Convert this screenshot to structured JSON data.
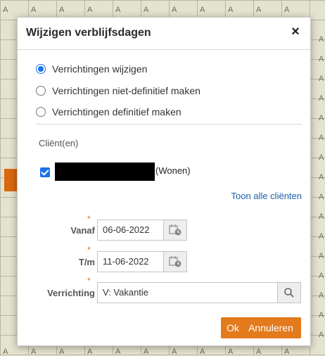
{
  "background": {
    "letter": "A"
  },
  "dialog": {
    "title": "Wijzigen verblijfsdagen",
    "close_label": "×",
    "options": [
      {
        "label": "Verrichtingen wijzigen",
        "checked": true
      },
      {
        "label": "Verrichtingen niet-definitief maken",
        "checked": false
      },
      {
        "label": "Verrichtingen definitief maken",
        "checked": false
      }
    ],
    "clients_label": "Cliënt(en)",
    "client_suffix": "(Wonen)",
    "client_checked": true,
    "show_all_label": "Toon alle cliënten",
    "from_label": "Vanaf",
    "from_value": "06-06-2022",
    "to_label": "T/m",
    "to_value": "11-06-2022",
    "action_label": "Verrichting",
    "action_value": "V: Vakantie",
    "required_marker": "*",
    "ok_label": "Ok",
    "cancel_label": "Annuleren"
  },
  "colors": {
    "accent": "#e37a1c",
    "radio_selected": "#1a73e8",
    "link": "#1a5fa8"
  },
  "icons": {
    "calendar": "calendar-clock-icon",
    "search": "search-icon",
    "close": "close-icon"
  }
}
